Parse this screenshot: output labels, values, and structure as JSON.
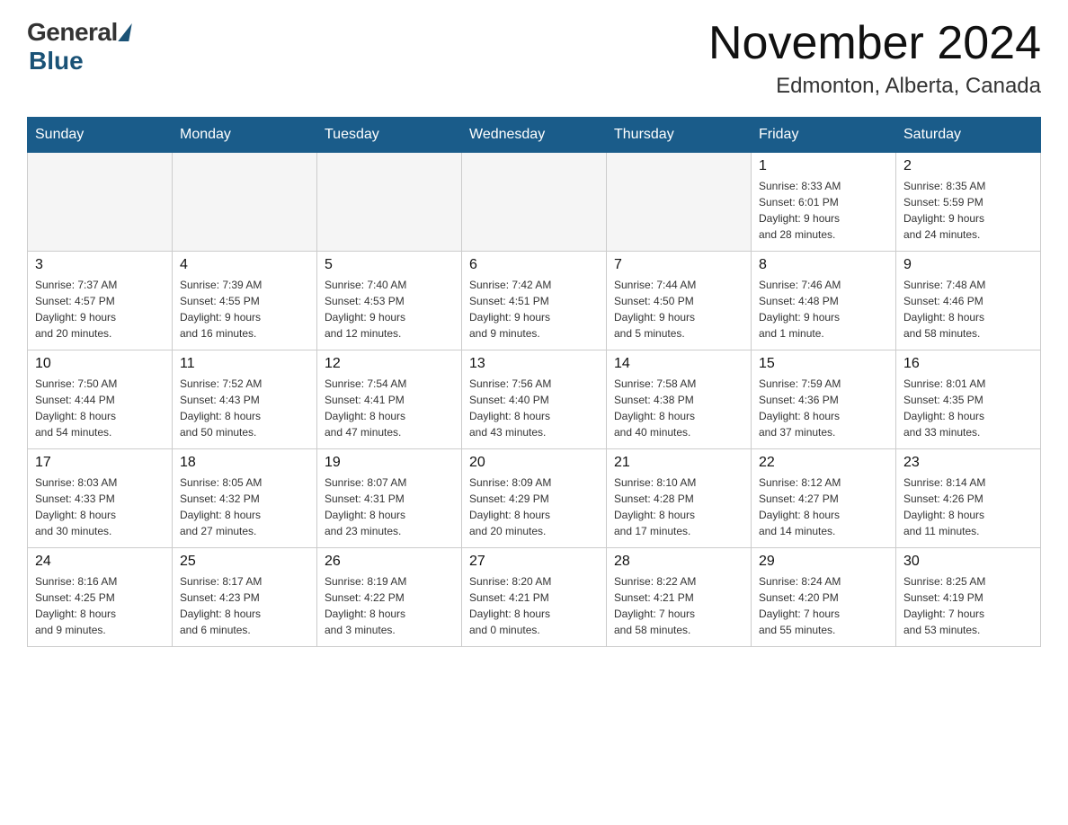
{
  "header": {
    "logo_general": "General",
    "logo_blue": "Blue",
    "month_title": "November 2024",
    "location": "Edmonton, Alberta, Canada"
  },
  "days_of_week": [
    "Sunday",
    "Monday",
    "Tuesday",
    "Wednesday",
    "Thursday",
    "Friday",
    "Saturday"
  ],
  "weeks": [
    [
      {
        "day": "",
        "info": ""
      },
      {
        "day": "",
        "info": ""
      },
      {
        "day": "",
        "info": ""
      },
      {
        "day": "",
        "info": ""
      },
      {
        "day": "",
        "info": ""
      },
      {
        "day": "1",
        "info": "Sunrise: 8:33 AM\nSunset: 6:01 PM\nDaylight: 9 hours\nand 28 minutes."
      },
      {
        "day": "2",
        "info": "Sunrise: 8:35 AM\nSunset: 5:59 PM\nDaylight: 9 hours\nand 24 minutes."
      }
    ],
    [
      {
        "day": "3",
        "info": "Sunrise: 7:37 AM\nSunset: 4:57 PM\nDaylight: 9 hours\nand 20 minutes."
      },
      {
        "day": "4",
        "info": "Sunrise: 7:39 AM\nSunset: 4:55 PM\nDaylight: 9 hours\nand 16 minutes."
      },
      {
        "day": "5",
        "info": "Sunrise: 7:40 AM\nSunset: 4:53 PM\nDaylight: 9 hours\nand 12 minutes."
      },
      {
        "day": "6",
        "info": "Sunrise: 7:42 AM\nSunset: 4:51 PM\nDaylight: 9 hours\nand 9 minutes."
      },
      {
        "day": "7",
        "info": "Sunrise: 7:44 AM\nSunset: 4:50 PM\nDaylight: 9 hours\nand 5 minutes."
      },
      {
        "day": "8",
        "info": "Sunrise: 7:46 AM\nSunset: 4:48 PM\nDaylight: 9 hours\nand 1 minute."
      },
      {
        "day": "9",
        "info": "Sunrise: 7:48 AM\nSunset: 4:46 PM\nDaylight: 8 hours\nand 58 minutes."
      }
    ],
    [
      {
        "day": "10",
        "info": "Sunrise: 7:50 AM\nSunset: 4:44 PM\nDaylight: 8 hours\nand 54 minutes."
      },
      {
        "day": "11",
        "info": "Sunrise: 7:52 AM\nSunset: 4:43 PM\nDaylight: 8 hours\nand 50 minutes."
      },
      {
        "day": "12",
        "info": "Sunrise: 7:54 AM\nSunset: 4:41 PM\nDaylight: 8 hours\nand 47 minutes."
      },
      {
        "day": "13",
        "info": "Sunrise: 7:56 AM\nSunset: 4:40 PM\nDaylight: 8 hours\nand 43 minutes."
      },
      {
        "day": "14",
        "info": "Sunrise: 7:58 AM\nSunset: 4:38 PM\nDaylight: 8 hours\nand 40 minutes."
      },
      {
        "day": "15",
        "info": "Sunrise: 7:59 AM\nSunset: 4:36 PM\nDaylight: 8 hours\nand 37 minutes."
      },
      {
        "day": "16",
        "info": "Sunrise: 8:01 AM\nSunset: 4:35 PM\nDaylight: 8 hours\nand 33 minutes."
      }
    ],
    [
      {
        "day": "17",
        "info": "Sunrise: 8:03 AM\nSunset: 4:33 PM\nDaylight: 8 hours\nand 30 minutes."
      },
      {
        "day": "18",
        "info": "Sunrise: 8:05 AM\nSunset: 4:32 PM\nDaylight: 8 hours\nand 27 minutes."
      },
      {
        "day": "19",
        "info": "Sunrise: 8:07 AM\nSunset: 4:31 PM\nDaylight: 8 hours\nand 23 minutes."
      },
      {
        "day": "20",
        "info": "Sunrise: 8:09 AM\nSunset: 4:29 PM\nDaylight: 8 hours\nand 20 minutes."
      },
      {
        "day": "21",
        "info": "Sunrise: 8:10 AM\nSunset: 4:28 PM\nDaylight: 8 hours\nand 17 minutes."
      },
      {
        "day": "22",
        "info": "Sunrise: 8:12 AM\nSunset: 4:27 PM\nDaylight: 8 hours\nand 14 minutes."
      },
      {
        "day": "23",
        "info": "Sunrise: 8:14 AM\nSunset: 4:26 PM\nDaylight: 8 hours\nand 11 minutes."
      }
    ],
    [
      {
        "day": "24",
        "info": "Sunrise: 8:16 AM\nSunset: 4:25 PM\nDaylight: 8 hours\nand 9 minutes."
      },
      {
        "day": "25",
        "info": "Sunrise: 8:17 AM\nSunset: 4:23 PM\nDaylight: 8 hours\nand 6 minutes."
      },
      {
        "day": "26",
        "info": "Sunrise: 8:19 AM\nSunset: 4:22 PM\nDaylight: 8 hours\nand 3 minutes."
      },
      {
        "day": "27",
        "info": "Sunrise: 8:20 AM\nSunset: 4:21 PM\nDaylight: 8 hours\nand 0 minutes."
      },
      {
        "day": "28",
        "info": "Sunrise: 8:22 AM\nSunset: 4:21 PM\nDaylight: 7 hours\nand 58 minutes."
      },
      {
        "day": "29",
        "info": "Sunrise: 8:24 AM\nSunset: 4:20 PM\nDaylight: 7 hours\nand 55 minutes."
      },
      {
        "day": "30",
        "info": "Sunrise: 8:25 AM\nSunset: 4:19 PM\nDaylight: 7 hours\nand 53 minutes."
      }
    ]
  ]
}
